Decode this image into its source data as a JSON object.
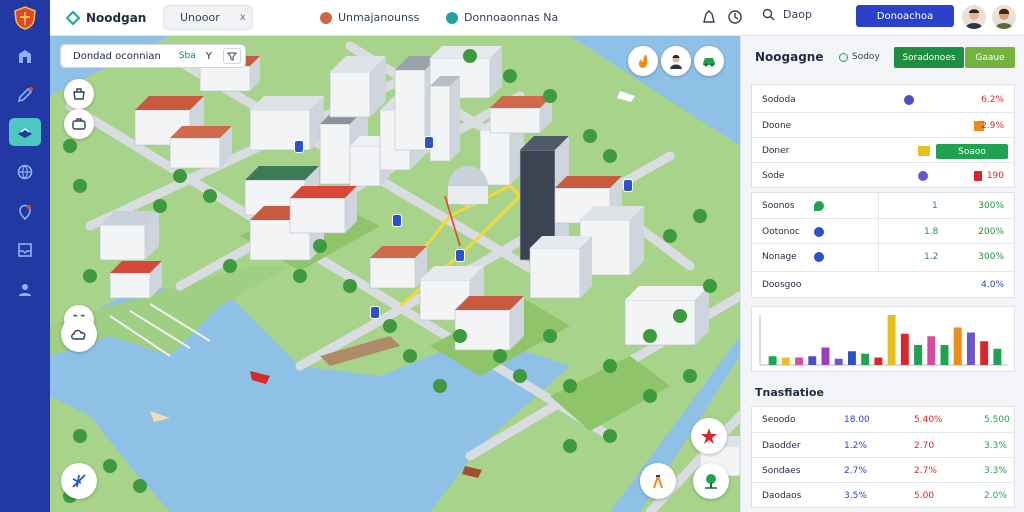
{
  "app": {
    "brand": "Noodgan",
    "tabs": [
      {
        "label": "Unooor",
        "close": "x"
      },
      {
        "label": "Unmajanounss"
      },
      {
        "label": "Donnoaonnas Na"
      }
    ],
    "search_label": "Daop",
    "cta_label": "Donoachoa"
  },
  "map": {
    "search_text": "Dondad oconnian",
    "search_tag": "Sba",
    "search_sep": "Y",
    "pins": [
      "",
      "",
      "",
      "",
      "",
      ""
    ]
  },
  "panel": {
    "title": "Noogagne",
    "radio_label": "Sodoy",
    "btn_primary": "Soradonoes",
    "btn_secondary": "Gaaue",
    "card1": [
      {
        "label": "Sododa",
        "value": "6.2%",
        "marker": "#4a4fc6",
        "marker_shape": "circle"
      },
      {
        "label": "Doone",
        "value": "2.9%",
        "marker": "#ef8a1c",
        "marker_shape": "square"
      },
      {
        "label": "Doner",
        "value": "",
        "marker": "#e4c11c",
        "marker_shape": "square",
        "bar_label": "Soaoo"
      },
      {
        "label": "Sode",
        "value": "190",
        "marker": "#6c56c9",
        "marker_shape": "circle",
        "value_marker": "#d7282e"
      }
    ],
    "card2": [
      {
        "label": "Soonos",
        "value": "300%",
        "mid": "1",
        "marker": "#1fa351",
        "marker_shape": "leaf"
      },
      {
        "label": "Ootonoc",
        "value": "200%",
        "mid": "1.8",
        "marker": "#2b52c9",
        "marker_shape": "circle"
      },
      {
        "label": "Nonage",
        "value": "300%",
        "mid": "1.2",
        "marker": "#2b52c9",
        "marker_shape": "circle"
      },
      {
        "label": "Doosgoo",
        "value": "4.0%",
        "mid": ""
      }
    ],
    "chart_data": {
      "type": "bar",
      "categories": [
        "",
        "",
        "",
        "",
        "",
        "",
        "",
        "",
        "",
        "",
        "",
        "",
        "",
        "",
        "",
        "",
        "",
        ""
      ],
      "values": [
        14,
        12,
        12,
        14,
        28,
        10,
        22,
        18,
        12,
        80,
        50,
        32,
        46,
        32,
        60,
        52,
        38,
        26
      ],
      "colors": [
        "#1fa351",
        "#e4c11c",
        "#d44ea0",
        "#4a4fc6",
        "#9a3fbf",
        "#6c56c9",
        "#2b52c9",
        "#1fa351",
        "#d7282e",
        "#e4c11c",
        "#d7282e",
        "#1fa351",
        "#d44ea0",
        "#1fa351",
        "#ef8a1c",
        "#6c56c9",
        "#d7282e",
        "#1fa351"
      ],
      "ylim": [
        0,
        80
      ],
      "grid": false
    },
    "table_title": "Tnasfiatioe",
    "table": {
      "rows": [
        [
          "Seoodo",
          "18.00",
          "5.40%",
          "5.500"
        ],
        [
          "Daodder",
          "1.2%",
          "2.70",
          "3.3%"
        ],
        [
          "Sondaes",
          "2.7%",
          "2.7%",
          "3.3%"
        ],
        [
          "Daodaos",
          "3.5%",
          "5.00",
          "2.0%"
        ]
      ],
      "colors": [
        "#1f2a44",
        "#2c41c9",
        "#d7282e",
        "#1fa351"
      ]
    }
  }
}
